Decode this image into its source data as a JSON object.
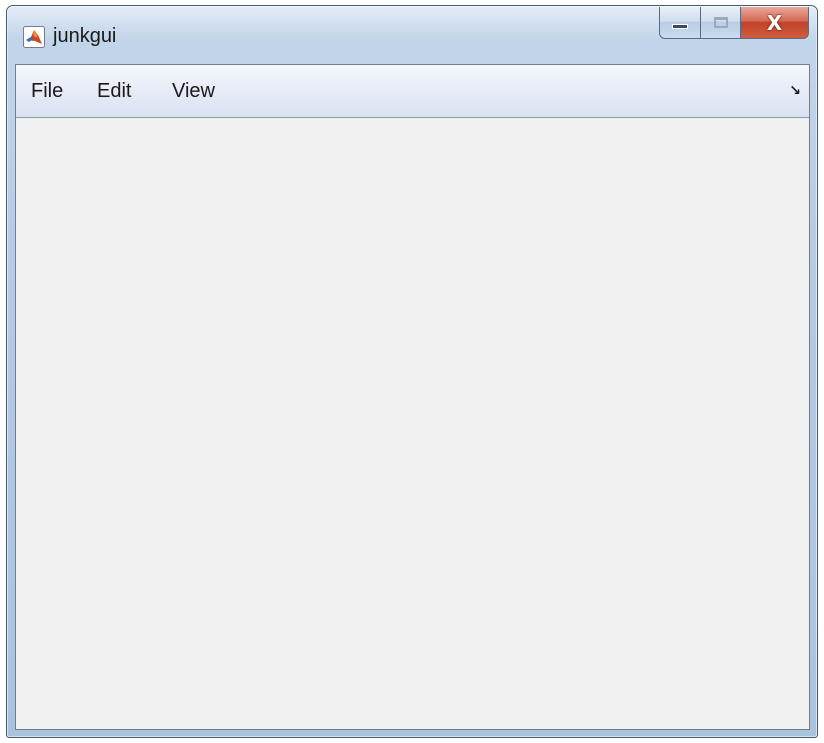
{
  "window": {
    "title": "junkgui",
    "icon": "matlab-logo-icon",
    "close_glyph": "X"
  },
  "menubar": {
    "items": [
      {
        "label": "File"
      },
      {
        "label": "Edit"
      },
      {
        "label": "View"
      }
    ],
    "dock_icon": "dock-arrow-icon",
    "dock_glyph": "↘"
  },
  "colors": {
    "close_button": "#c0422a",
    "client_background": "#f0f0f0",
    "frame": "#b3cae4"
  }
}
